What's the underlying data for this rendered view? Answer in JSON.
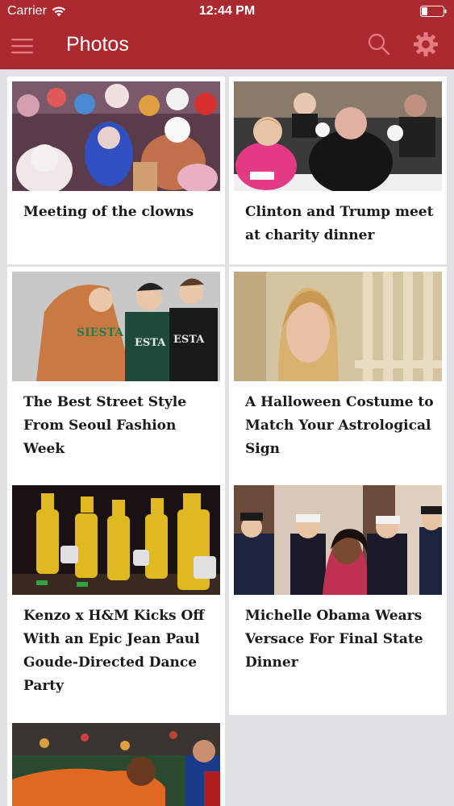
{
  "status_bar": {
    "carrier": "Carrier",
    "time": "12:44 PM"
  },
  "header": {
    "title": "Photos",
    "menu_icon": "hamburger-menu-icon",
    "search_icon": "search-icon",
    "settings_icon": "gear-icon"
  },
  "colors": {
    "header_bg": "#ac2a2f",
    "page_bg": "#e2e2e4",
    "card_bg": "#ffffff",
    "headline_text": "#1a1a1a"
  },
  "articles": [
    {
      "headline": "Meeting of the clowns"
    },
    {
      "headline": "Clinton and Trump meet at charity dinner"
    },
    {
      "headline": "The Best Street Style From Seoul Fashion Week"
    },
    {
      "headline": "A Halloween Costume to Match Your Astrological Sign"
    },
    {
      "headline": "Kenzo x H&M Kicks Off With an Epic Jean Paul Goude-Directed Dance Party"
    },
    {
      "headline": "Michelle Obama Wears Versace For Final State Dinner"
    },
    {
      "headline": ""
    }
  ]
}
